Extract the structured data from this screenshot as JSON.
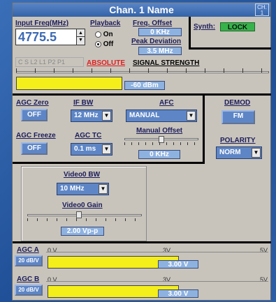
{
  "window": {
    "title": "Chan. 1 Name",
    "channel_badge": "CH. 1"
  },
  "input_freq": {
    "label": "Input Freq(MHz)",
    "value": "4775.5"
  },
  "playback": {
    "label": "Playback",
    "on": "On",
    "off": "Off",
    "selected": "Off"
  },
  "freq_offset": {
    "label": "Freq. Offset",
    "value": "0 KHz"
  },
  "peak_deviation": {
    "label": "Peak Deviation",
    "value": "3.5 MHz"
  },
  "synth": {
    "label": "Synth:",
    "status": "LOCK"
  },
  "signal_strength": {
    "mode_tabs": "C S L2 L1 P2 P1",
    "absolute": "ABSOLUTE",
    "label": "SIGNAL STRENGTH",
    "value": "-60 dBm",
    "fill_fraction": 0.53
  },
  "agc_zero": {
    "label": "AGC  Zero",
    "value": "OFF"
  },
  "if_bw": {
    "label": "IF BW",
    "value": "12 MHz"
  },
  "afc": {
    "label": "AFC",
    "value": "MANUAL"
  },
  "manual_offset": {
    "label": "Manual Offset",
    "value": "0 KHz"
  },
  "demod": {
    "label": "DEMOD",
    "value": "FM"
  },
  "polarity": {
    "label": "POLARITY",
    "value": "NORM"
  },
  "agc_freeze": {
    "label": "AGC Freeze",
    "value": "OFF"
  },
  "agc_tc": {
    "label": "AGC TC",
    "value": "0.1 ms"
  },
  "video0_bw": {
    "label": "Video0 BW",
    "value": "10 MHz"
  },
  "video0_gain": {
    "label": "Video0 Gain",
    "value": "2.00 Vp-p"
  },
  "agc_a": {
    "label": "AGC A",
    "scale": "20 dB/V",
    "value": "3.00 V",
    "tick_0": "0 V",
    "tick_mid": "3V",
    "tick_max": "5V",
    "fill_fraction": 0.6
  },
  "agc_b": {
    "label": "AGC B",
    "scale": "20 dB/V",
    "value": "3.00 V",
    "tick_0": "0 V",
    "tick_mid": "3V",
    "tick_max": "5V",
    "fill_fraction": 0.6
  }
}
